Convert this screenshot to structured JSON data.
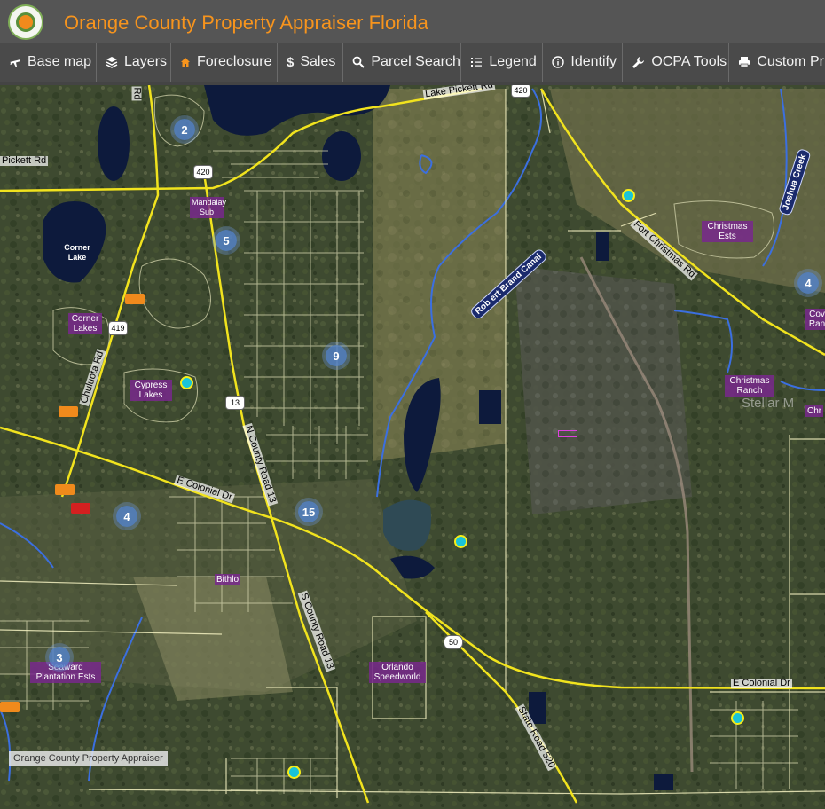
{
  "header": {
    "title": "Orange County Property Appraiser Florida",
    "title_color": "#f7941d"
  },
  "toolbar": {
    "items": [
      {
        "label": "Base map",
        "icon": "airplane-icon"
      },
      {
        "label": "Layers",
        "icon": "layers-icon"
      },
      {
        "label": "Foreclosure",
        "icon": "home-icon"
      },
      {
        "label": "Sales",
        "icon": "dollar-icon"
      },
      {
        "label": "Parcel Search",
        "icon": "search-icon"
      },
      {
        "label": "Legend",
        "icon": "list-icon"
      },
      {
        "label": "Identify",
        "icon": "info-icon"
      },
      {
        "label": "OCPA Tools",
        "icon": "wrench-icon"
      },
      {
        "label": "Custom Pri",
        "icon": "printer-icon"
      }
    ]
  },
  "map": {
    "place_labels": {
      "corner_lake": "Corner Lake",
      "mandalay_sub": "Mandalay Sub",
      "corner_lakes": "Corner Lakes",
      "cypress_lakes": "Cypress Lakes",
      "christmas_ests": "Christmas Ests",
      "christmas_ranch": "Christmas Ranch",
      "cov_ranch": "Cov Ran",
      "chr": "Chr",
      "bithlo": "Bithlo",
      "seaward": "Seaward Plantation Ests",
      "orlando_speedworld": "Orlando Speedworld"
    },
    "road_labels": {
      "pickett": "Pickett Rd",
      "lake_pickett": "Lake Pickett Rd",
      "chuluota": "Chuluota Rd",
      "n_county_13": "N County Road 13",
      "s_county_13": "S County Road 13",
      "e_colonial_west": "E Colonial Dr",
      "e_colonial_east": "E Colonial Dr",
      "fort_christmas": "Fort Christmas Rd",
      "state_road_520": "State Road 520",
      "rd_top": "Rd"
    },
    "stream_labels": {
      "joshua_creek": "Joshua Creek",
      "robbins_canal": "Rob ert Brand Canal"
    },
    "shields": {
      "r420_top": "420",
      "r420": "420",
      "r419": "419",
      "r13": "13",
      "r50": "50"
    },
    "clusters": [
      "2",
      "5",
      "9",
      "4",
      "15",
      "4",
      "3"
    ],
    "marker_count": 6,
    "attribution": "Orange County Property Appraiser",
    "watermark": "Stellar M"
  }
}
